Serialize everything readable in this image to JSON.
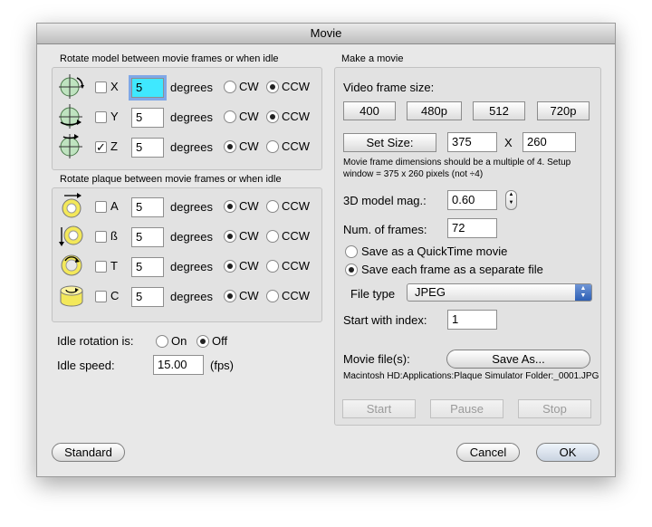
{
  "window": {
    "title": "Movie"
  },
  "rotate_model": {
    "header": "Rotate model between movie frames or when idle",
    "rows": [
      {
        "axis": "X",
        "checked": false,
        "value": "5",
        "unit": "degrees",
        "cw": "CW",
        "ccw": "CCW",
        "selected": "CCW",
        "icon": "rotate-x-icon"
      },
      {
        "axis": "Y",
        "checked": false,
        "value": "5",
        "unit": "degrees",
        "cw": "CW",
        "ccw": "CCW",
        "selected": "CCW",
        "icon": "rotate-y-icon"
      },
      {
        "axis": "Z",
        "checked": true,
        "value": "5",
        "unit": "degrees",
        "cw": "CW",
        "ccw": "CCW",
        "selected": "CW",
        "icon": "rotate-z-icon"
      }
    ]
  },
  "rotate_plaque": {
    "header": "Rotate plaque between movie frames or when idle",
    "rows": [
      {
        "axis": "A",
        "checked": false,
        "value": "5",
        "unit": "degrees",
        "cw": "CW",
        "ccw": "CCW",
        "selected": "CW",
        "icon": "plaque-rotate-a-icon"
      },
      {
        "axis": "ß",
        "checked": false,
        "value": "5",
        "unit": "degrees",
        "cw": "CW",
        "ccw": "CCW",
        "selected": "CW",
        "icon": "plaque-rotate-b-icon"
      },
      {
        "axis": "T",
        "checked": false,
        "value": "5",
        "unit": "degrees",
        "cw": "CW",
        "ccw": "CCW",
        "selected": "CW",
        "icon": "plaque-rotate-t-icon"
      },
      {
        "axis": "C",
        "checked": false,
        "value": "5",
        "unit": "degrees",
        "cw": "CW",
        "ccw": "CCW",
        "selected": "CW",
        "icon": "plaque-rotate-c-icon"
      }
    ]
  },
  "idle": {
    "rotation_label": "Idle rotation is:",
    "on": "On",
    "off": "Off",
    "selected": "Off",
    "speed_label": "Idle speed:",
    "speed_value": "15.00",
    "speed_unit": "(fps)"
  },
  "movie": {
    "header": "Make a movie",
    "frame_size_label": "Video frame size:",
    "size_buttons": [
      "400",
      "480p",
      "512",
      "720p"
    ],
    "set_size": "Set Size:",
    "width": "375",
    "x": "X",
    "height": "260",
    "note": "Movie frame dimensions should be a multiple of 4. Setup window = 375 x 260 pixels (not ÷4)",
    "mag_label": "3D model mag.:",
    "mag_value": "0.60",
    "frames_label": "Num. of frames:",
    "frames_value": "72",
    "save_quicktime": "Save as a QuickTime movie",
    "save_frames": "Save each frame as a separate file",
    "save_selected": "frames",
    "file_type_label": "File type",
    "file_type_value": "JPEG",
    "start_index_label": "Start with index:",
    "start_index_value": "1",
    "movie_files_label": "Movie file(s):",
    "save_as": "Save As...",
    "path": "Macintosh HD:Applications:Plaque Simulator Folder:_0001.JPG",
    "start": "Start",
    "pause": "Pause",
    "stop": "Stop"
  },
  "footer": {
    "standard": "Standard",
    "cancel": "Cancel",
    "ok": "OK"
  }
}
